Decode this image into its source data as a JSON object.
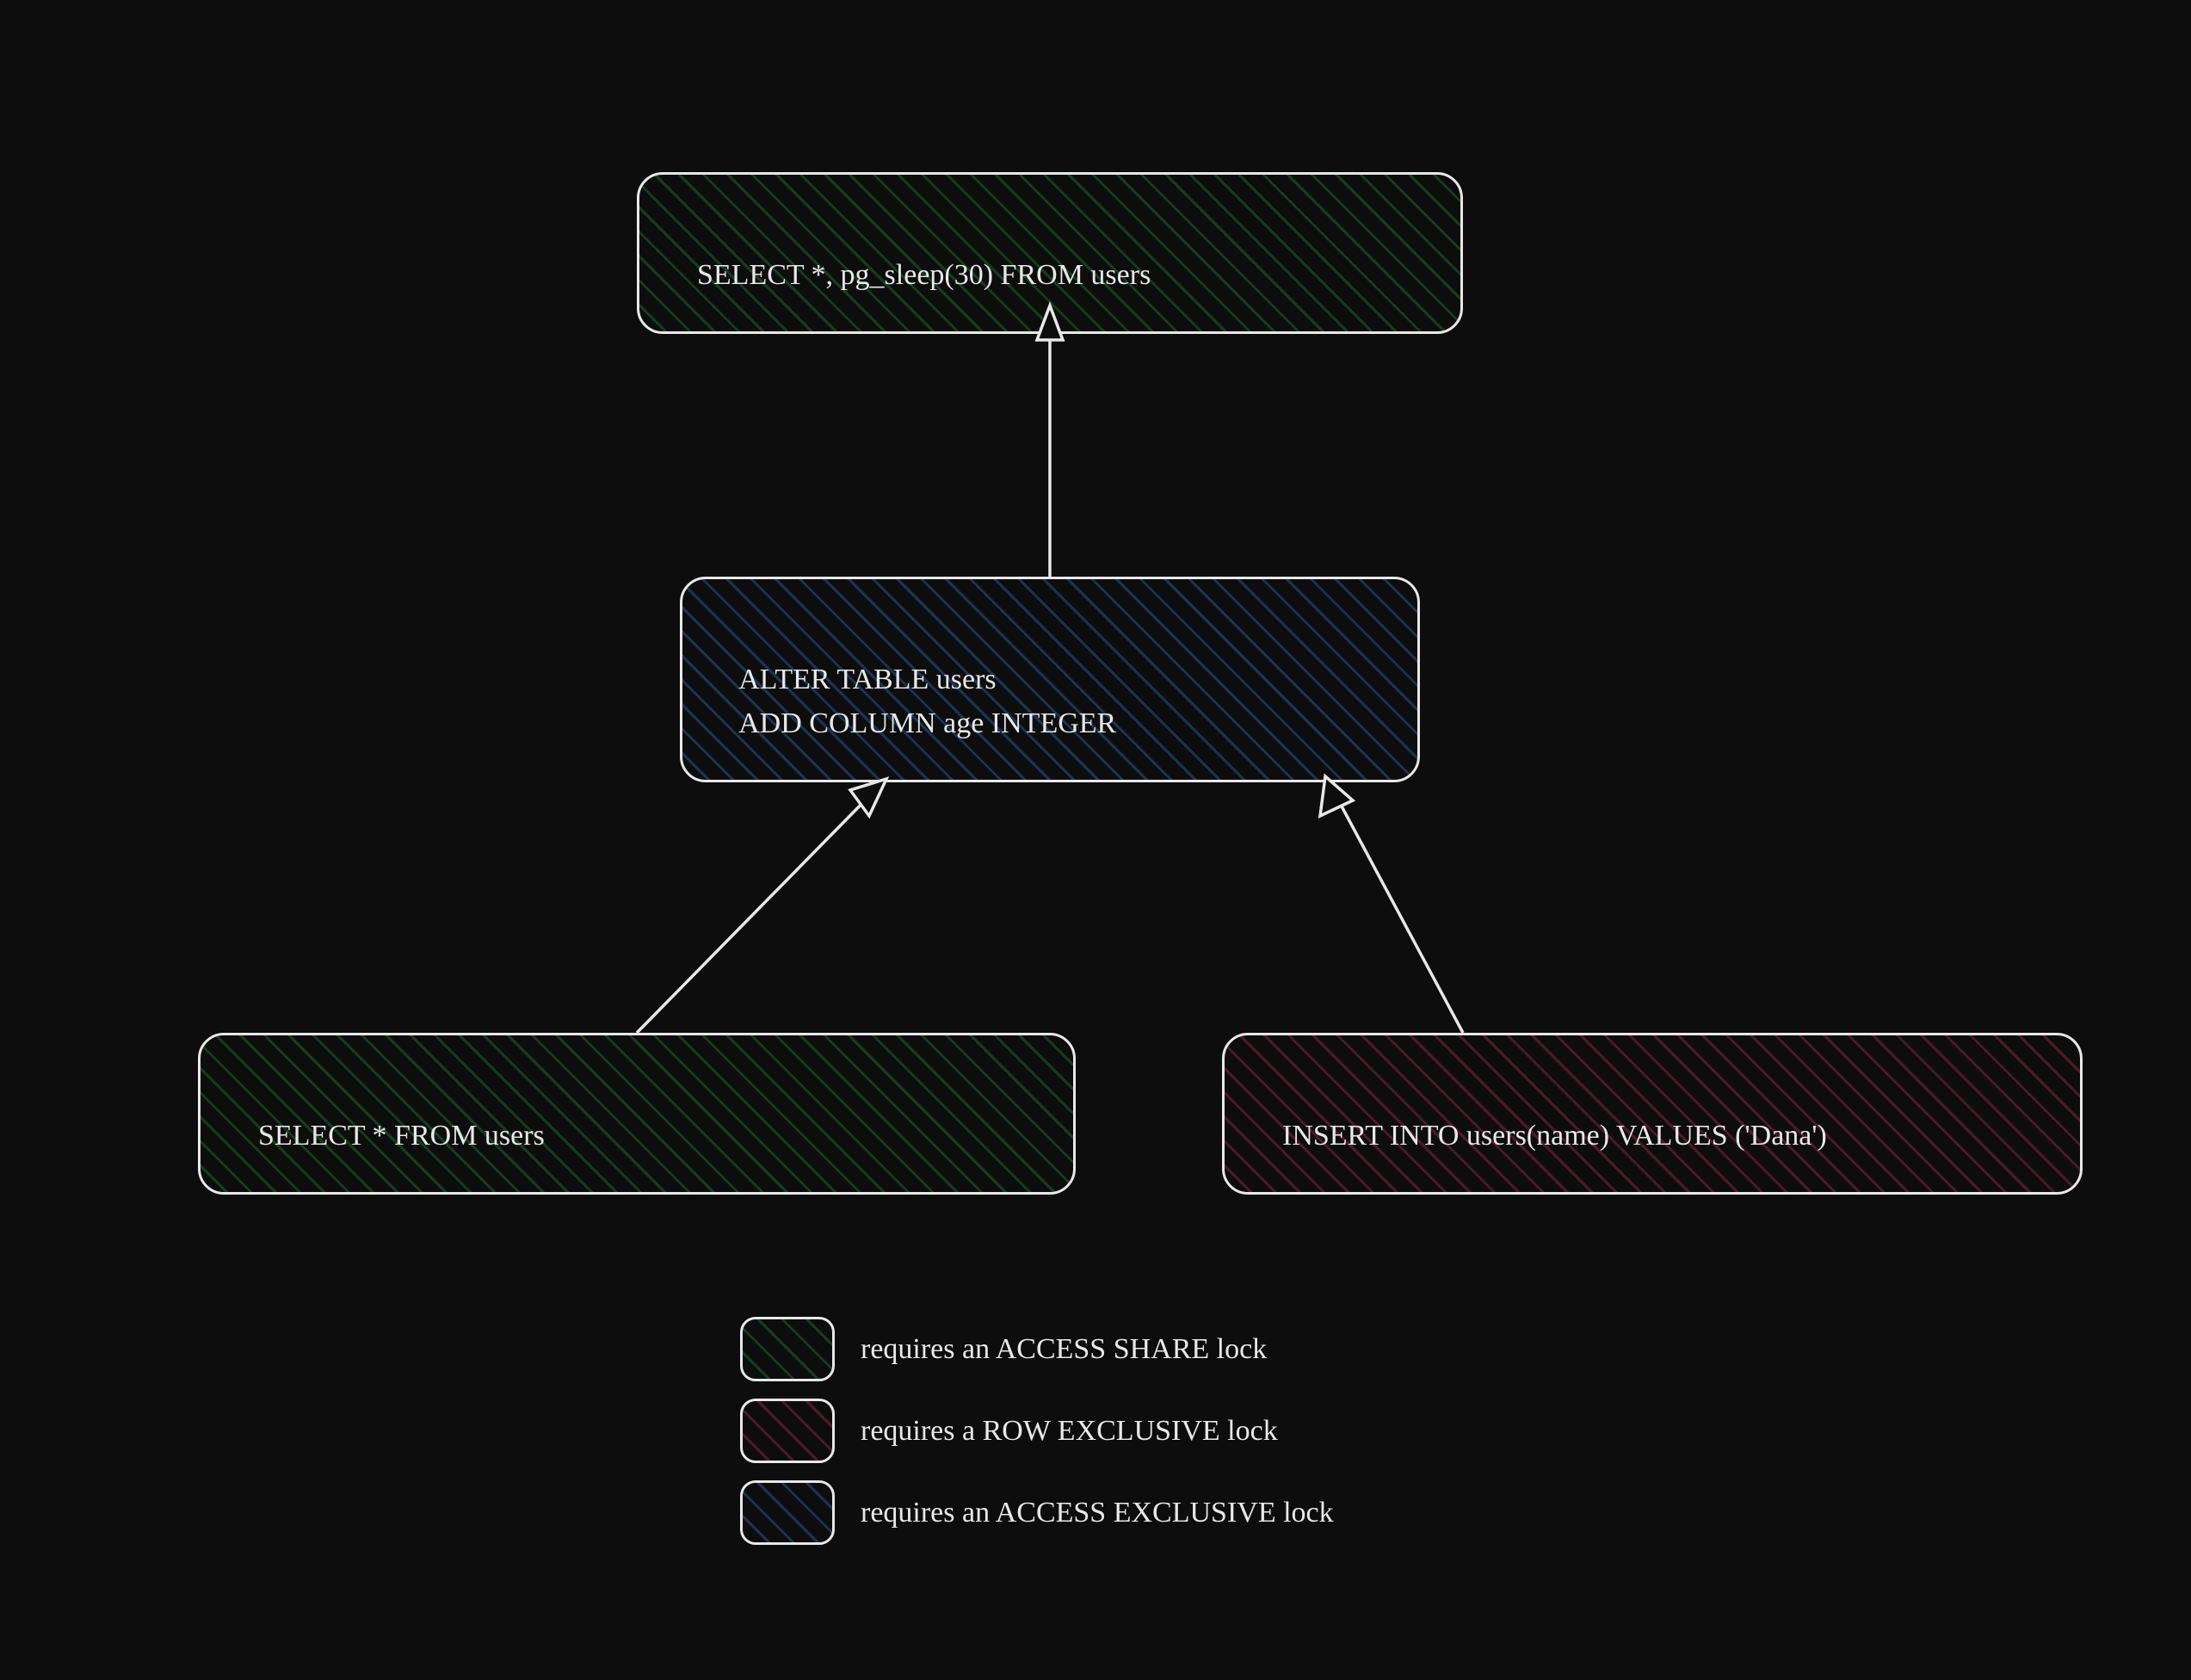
{
  "nodes": {
    "top": {
      "text": "SELECT *, pg_sleep(30) FROM users",
      "lock": "access_share"
    },
    "middle": {
      "text": "ALTER TABLE users\n  ADD COLUMN age INTEGER",
      "lock": "access_exclusive"
    },
    "bottom_left": {
      "text": "SELECT * FROM users",
      "lock": "access_share"
    },
    "bottom_right": {
      "text": "INSERT INTO users(name) VALUES ('Dana')",
      "lock": "row_exclusive"
    }
  },
  "legend": {
    "access_share": "requires an ACCESS SHARE lock",
    "row_exclusive": "requires a ROW EXCLUSIVE lock",
    "access_exclusive": "requires an ACCESS EXCLUSIVE lock"
  },
  "colors": {
    "access_share": "#1e7832",
    "row_exclusive": "#a02846",
    "access_exclusive": "#285aa0",
    "border": "#e8e8e8",
    "background": "#0d0d0d"
  },
  "arrows": [
    {
      "from": "middle",
      "to": "top"
    },
    {
      "from": "bottom_left",
      "to": "middle"
    },
    {
      "from": "bottom_right",
      "to": "middle"
    }
  ]
}
